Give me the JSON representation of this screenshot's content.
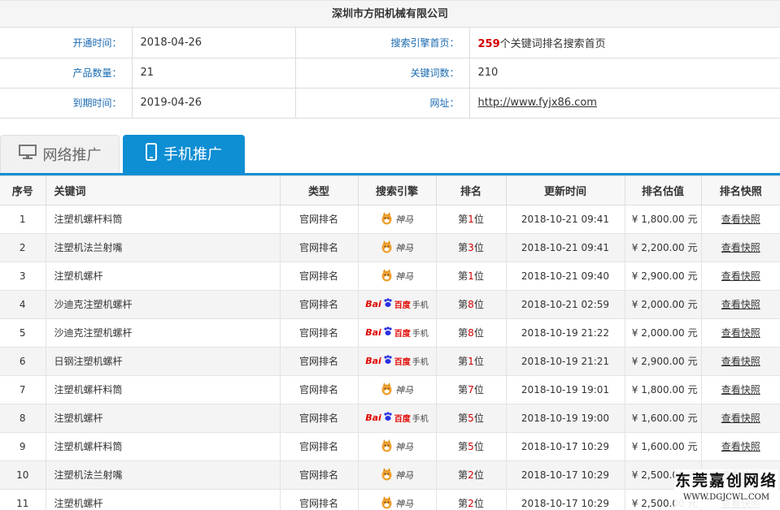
{
  "company": {
    "name": "深圳市方阳机械有限公司"
  },
  "info": {
    "open_time_label": "开通时间：",
    "open_time": "2018-04-26",
    "engine_home_label": "搜索引擎首页：",
    "engine_home_count": "259",
    "engine_home_suffix": "个关键词排名搜索首页",
    "product_count_label": "产品数量：",
    "product_count": "21",
    "keyword_count_label": "关键词数：",
    "keyword_count": "210",
    "expire_label": "到期时间：",
    "expire": "2019-04-26",
    "site_label": "网址：",
    "site": "http://www.fyjx86.com"
  },
  "tabs": {
    "web": "网络推广",
    "mobile": "手机推广",
    "active": "mobile"
  },
  "table": {
    "headers": [
      "序号",
      "关键词",
      "类型",
      "搜索引擎",
      "排名",
      "更新时间",
      "排名估值",
      "排名快照"
    ],
    "rows": [
      {
        "no": "1",
        "keyword": "注塑机螺杆料筒",
        "type": "官网排名",
        "engine": "shenma",
        "rank": "第1位",
        "time": "2018-10-21 09:41",
        "price": "¥ 1,800.00 元",
        "snapshot": "查看快照"
      },
      {
        "no": "2",
        "keyword": "注塑机法兰射嘴",
        "type": "官网排名",
        "engine": "shenma",
        "rank": "第3位",
        "time": "2018-10-21 09:41",
        "price": "¥ 2,200.00 元",
        "snapshot": "查看快照"
      },
      {
        "no": "3",
        "keyword": "注塑机螺杆",
        "type": "官网排名",
        "engine": "shenma",
        "rank": "第1位",
        "time": "2018-10-21 09:40",
        "price": "¥ 2,900.00 元",
        "snapshot": "查看快照"
      },
      {
        "no": "4",
        "keyword": "沙迪克注塑机螺杆",
        "type": "官网排名",
        "engine": "baidu",
        "rank": "第8位",
        "time": "2018-10-21 02:59",
        "price": "¥ 2,000.00 元",
        "snapshot": "查看快照"
      },
      {
        "no": "5",
        "keyword": "沙迪克注塑机螺杆",
        "type": "官网排名",
        "engine": "baidu",
        "rank": "第8位",
        "time": "2018-10-19 21:22",
        "price": "¥ 2,000.00 元",
        "snapshot": "查看快照"
      },
      {
        "no": "6",
        "keyword": "日钢注塑机螺杆",
        "type": "官网排名",
        "engine": "baidu",
        "rank": "第1位",
        "time": "2018-10-19 21:21",
        "price": "¥ 2,900.00 元",
        "snapshot": "查看快照"
      },
      {
        "no": "7",
        "keyword": "注塑机螺杆料筒",
        "type": "官网排名",
        "engine": "shenma",
        "rank": "第7位",
        "time": "2018-10-19 19:01",
        "price": "¥ 1,800.00 元",
        "snapshot": "查看快照"
      },
      {
        "no": "8",
        "keyword": "注塑机螺杆",
        "type": "官网排名",
        "engine": "baidu",
        "rank": "第5位",
        "time": "2018-10-19 19:00",
        "price": "¥ 1,600.00 元",
        "snapshot": "查看快照"
      },
      {
        "no": "9",
        "keyword": "注塑机螺杆料筒",
        "type": "官网排名",
        "engine": "shenma",
        "rank": "第5位",
        "time": "2018-10-17 10:29",
        "price": "¥ 1,600.00 元",
        "snapshot": "查看快照"
      },
      {
        "no": "10",
        "keyword": "注塑机法兰射嘴",
        "type": "官网排名",
        "engine": "shenma",
        "rank": "第2位",
        "time": "2018-10-17 10:29",
        "price": "¥ 2,500.00 元",
        "snapshot": "查看快照"
      },
      {
        "no": "11",
        "keyword": "注塑机螺杆",
        "type": "官网排名",
        "engine": "shenma",
        "rank": "第2位",
        "time": "2018-10-17 10:29",
        "price": "¥ 2,500.00 元",
        "snapshot": "查看快照"
      }
    ]
  },
  "engines": {
    "shenma": "神马",
    "baidu_prefix": "Bai",
    "baidu_du": "百度",
    "baidu_suffix": "手机"
  },
  "watermark": {
    "title": "东莞嘉创网络",
    "url": "WWW.DGJCWL.COM"
  },
  "colors": {
    "accent": "#0e8ed3",
    "highlight_red": "#d20000",
    "label_blue": "#1a6ab0"
  },
  "icons": {
    "web_tab": "monitor-icon",
    "mobile_tab": "phone-icon",
    "shenma": "shenma-horse-logo",
    "baidu": "baidu-paw-logo"
  }
}
